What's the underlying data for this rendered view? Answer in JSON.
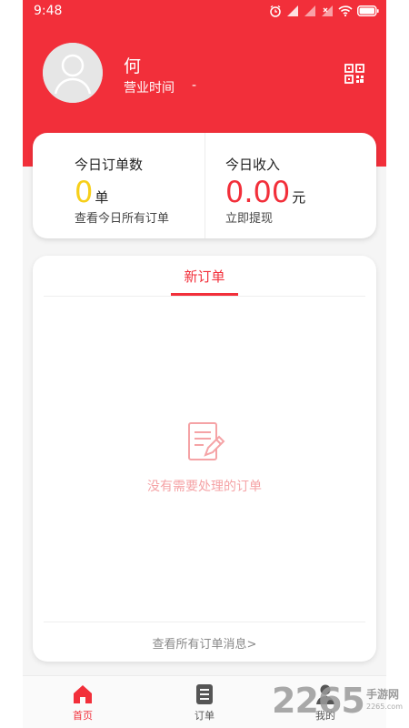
{
  "status_bar": {
    "time": "9:48"
  },
  "profile": {
    "name": "何",
    "hours_label": "营业时间",
    "hours_value": "-"
  },
  "stats": {
    "orders": {
      "title": "今日订单数",
      "value": "0",
      "unit": "单",
      "link": "查看今日所有订单"
    },
    "income": {
      "title": "今日收入",
      "value": "0.00",
      "unit": "元",
      "link": "立即提现"
    }
  },
  "orders_panel": {
    "tab_label": "新订单",
    "empty_message": "没有需要处理的订单",
    "view_all_label": "查看所有订单消息>"
  },
  "bottom_tabs": [
    {
      "label": "首页",
      "icon": "home-icon",
      "active": true
    },
    {
      "label": "订单",
      "icon": "order-list-icon",
      "active": false
    },
    {
      "label": "我的",
      "icon": "user-icon",
      "active": false
    }
  ],
  "watermark": {
    "number": "2265",
    "chinese": "手游网",
    "url": "2265.com"
  },
  "colors": {
    "brand_red": "#f22f3a",
    "yellow": "#f7cf1a",
    "empty_pink": "#f5a3a6"
  }
}
